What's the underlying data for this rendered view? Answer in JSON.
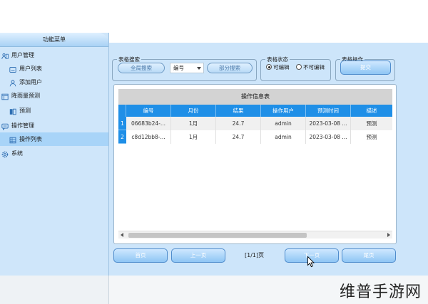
{
  "sidebar": {
    "title": "功能菜单",
    "items": [
      {
        "label": "用户管理",
        "level": 0,
        "icon": "users-group-icon"
      },
      {
        "label": "用户列表",
        "level": 1,
        "icon": "user-list-icon"
      },
      {
        "label": "添加用户",
        "level": 1,
        "icon": "add-user-icon"
      },
      {
        "label": "降雨量预测",
        "level": 0,
        "icon": "rain-forecast-icon"
      },
      {
        "label": "预测",
        "level": 1,
        "icon": "forecast-icon"
      },
      {
        "label": "操作管理",
        "level": 0,
        "icon": "operation-chat-icon"
      },
      {
        "label": "操作列表",
        "level": 1,
        "icon": "operation-list-icon",
        "selected": true
      },
      {
        "label": "系统",
        "level": 0,
        "icon": "gear-icon"
      }
    ]
  },
  "search": {
    "legend": "表格搜索",
    "global_label": "全局搜索",
    "field_select": "编号",
    "partial_label": "部分搜索"
  },
  "state": {
    "legend": "表格状态",
    "editable_label": "可编辑",
    "readonly_label": "不可编辑",
    "selected": "editable"
  },
  "ops": {
    "legend": "表格操作",
    "submit_label": "提交"
  },
  "table": {
    "title": "操作信息表",
    "columns": [
      "编号",
      "月份",
      "结果",
      "操作用户",
      "预测时间",
      "描述"
    ],
    "rows": [
      {
        "num": "1",
        "cells": [
          "06683b24-...",
          "1月",
          "24.7",
          "admin",
          "2023-03-08 ...",
          "预测"
        ]
      },
      {
        "num": "2",
        "cells": [
          "c8d12bb8-...",
          "1月",
          "24.7",
          "admin",
          "2023-03-08 ...",
          "预测"
        ]
      }
    ]
  },
  "pagination": {
    "first": "首页",
    "prev": "上一页",
    "info": "[1/1]页",
    "next": "下一页",
    "last": "尾页"
  },
  "watermark": "维普手游网"
}
